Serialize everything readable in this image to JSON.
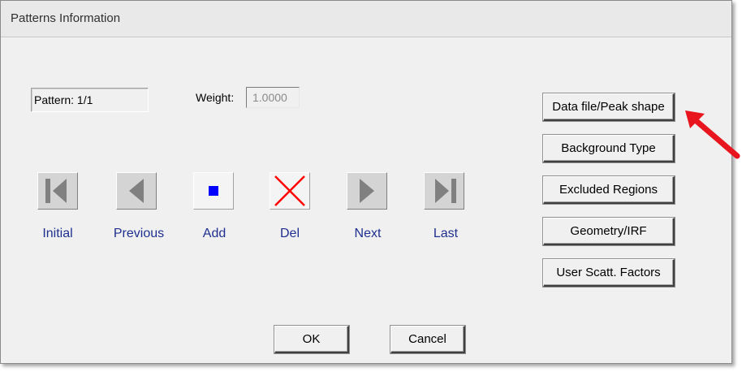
{
  "window": {
    "title": "Patterns Information"
  },
  "pattern_label": "Pattern: 1/1",
  "weight": {
    "label": "Weight:",
    "value": "1.0000"
  },
  "nav": {
    "initial": "Initial",
    "previous": "Previous",
    "add": "Add",
    "del": "Del",
    "next": "Next",
    "last": "Last"
  },
  "side_buttons": {
    "data_file": "Data file/Peak shape",
    "background": "Background Type",
    "excluded": "Excluded Regions",
    "geometry": "Geometry/IRF",
    "scatt": "User Scatt. Factors"
  },
  "dialog_buttons": {
    "ok": "OK",
    "cancel": "Cancel"
  },
  "colors": {
    "nav_label": "#1f2f8f",
    "add_square": "#0000ff",
    "del_cross": "#ff0000",
    "annotation_arrow": "#e8141e",
    "nav_icon_gray": "#808080"
  }
}
